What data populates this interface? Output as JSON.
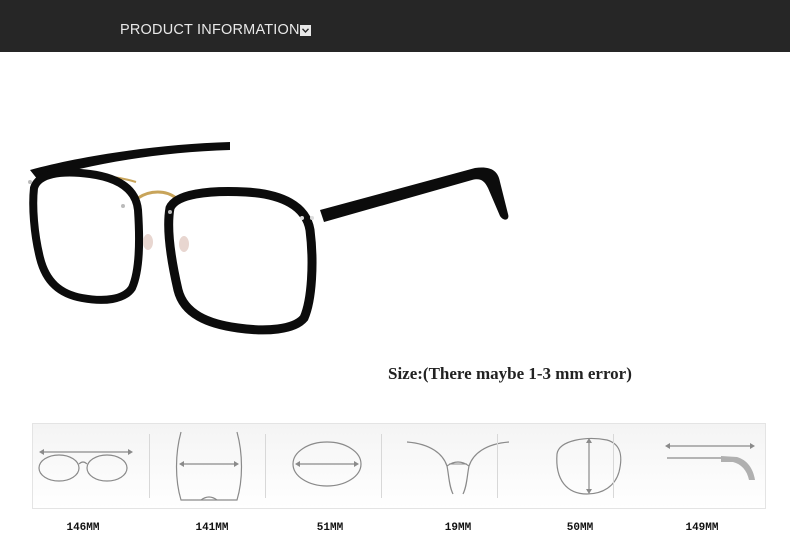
{
  "header": {
    "title": "PRODUCT INFORMATION",
    "toggle_icon": "chevron-down-icon",
    "background": "#262626",
    "text_color": "#e8e8e8"
  },
  "product_image": {
    "icon": "eyeglasses-icon",
    "frame_color": "#0c0c0c",
    "bridge_color": "#c8a45a"
  },
  "size_note": "Size:(There maybe 1-3 mm error)",
  "dimensions": [
    {
      "icon": "frame-width-icon",
      "value": "146MM"
    },
    {
      "icon": "temple-to-temple-icon",
      "value": "141MM"
    },
    {
      "icon": "lens-width-icon",
      "value": "51MM"
    },
    {
      "icon": "bridge-width-icon",
      "value": "19MM"
    },
    {
      "icon": "lens-height-icon",
      "value": "50MM"
    },
    {
      "icon": "temple-length-icon",
      "value": "149MM"
    }
  ]
}
